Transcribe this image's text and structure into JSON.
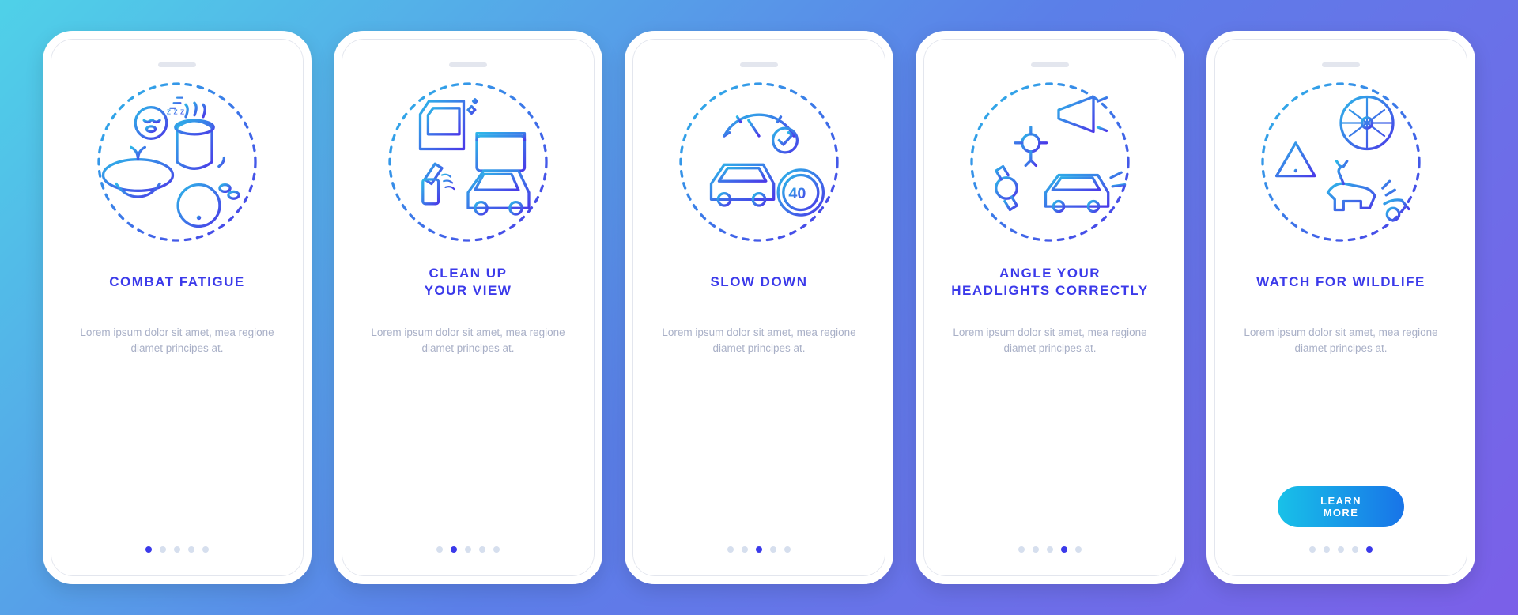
{
  "screens": [
    {
      "id": "combat-fatigue",
      "icon": "fatigue-icon",
      "title": "COMBAT FATIGUE",
      "desc": "Lorem ipsum dolor sit amet, mea regione diamet principes at.",
      "activeDot": 0,
      "cta": null
    },
    {
      "id": "clean-view",
      "icon": "clean-view-icon",
      "title": "CLEAN UP\nYOUR VIEW",
      "desc": "Lorem ipsum dolor sit amet, mea regione diamet principes at.",
      "activeDot": 1,
      "cta": null
    },
    {
      "id": "slow-down",
      "icon": "slow-down-icon",
      "title": "SLOW DOWN",
      "desc": "Lorem ipsum dolor sit amet, mea regione diamet principes at.",
      "activeDot": 2,
      "cta": null
    },
    {
      "id": "headlights",
      "icon": "headlights-icon",
      "title": "ANGLE YOUR\nHEADLIGHTS CORRECTLY",
      "desc": "Lorem ipsum dolor sit amet, mea regione diamet principes at.",
      "activeDot": 3,
      "cta": null
    },
    {
      "id": "wildlife",
      "icon": "wildlife-icon",
      "title": "WATCH FOR WILDLIFE",
      "desc": "Lorem ipsum dolor sit amet, mea regione diamet principes at.",
      "activeDot": 4,
      "cta": "LEARN MORE"
    }
  ],
  "dotCount": 5,
  "colors": {
    "gradientStart": "#4FD1E8",
    "gradientEnd": "#7B5FE8",
    "titleColor": "#3B3AEA",
    "descColor": "#A9B0C7",
    "iconStroke1": "#2DB6E8",
    "iconStroke2": "#4A3AE8"
  }
}
